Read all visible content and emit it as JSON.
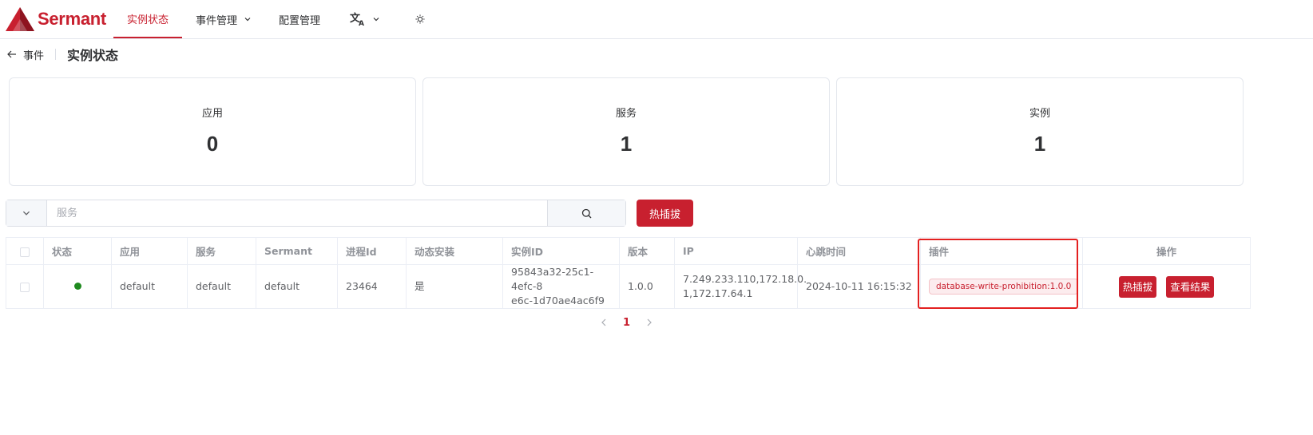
{
  "header": {
    "logo_text": "Sermant",
    "nav": [
      {
        "label": "实例状态",
        "active": true
      },
      {
        "label": "事件管理",
        "has_dropdown": true
      },
      {
        "label": "配置管理"
      }
    ],
    "language_icon": "translate-icon",
    "theme_icon": "sun-icon"
  },
  "breadcrumb": {
    "back_label": "事件",
    "title": "实例状态"
  },
  "stats": [
    {
      "label": "应用",
      "value": "0"
    },
    {
      "label": "服务",
      "value": "1"
    },
    {
      "label": "实例",
      "value": "1"
    }
  ],
  "search": {
    "placeholder": "服务",
    "hot_plug_label": "热插拔"
  },
  "table": {
    "headers": [
      "状态",
      "应用",
      "服务",
      "Sermant",
      "进程Id",
      "动态安装",
      "实例ID",
      "版本",
      "IP",
      "心跳时间",
      "插件",
      "操作"
    ],
    "rows": [
      {
        "status": "online",
        "app": "default",
        "service": "default",
        "sermant": "default",
        "pid": "23464",
        "dynamic_install": "是",
        "instance_id_line1": "95843a32-25c1-4efc-8",
        "instance_id_line2": "e6c-1d70ae4ac6f9",
        "version": "1.0.0",
        "ip_line1": "7.249.233.110,172.18.0.",
        "ip_line2": "1,172.17.64.1",
        "heartbeat": "2024-10-11 16:15:32",
        "plugin": "database-write-prohibition:1.0.0",
        "actions": [
          "热插拔",
          "查看结果"
        ]
      }
    ]
  },
  "pagination": {
    "current_page": "1"
  },
  "colors": {
    "brand": "#c8202f",
    "status_online": "#1f8a1f",
    "highlight": "#e32020"
  }
}
